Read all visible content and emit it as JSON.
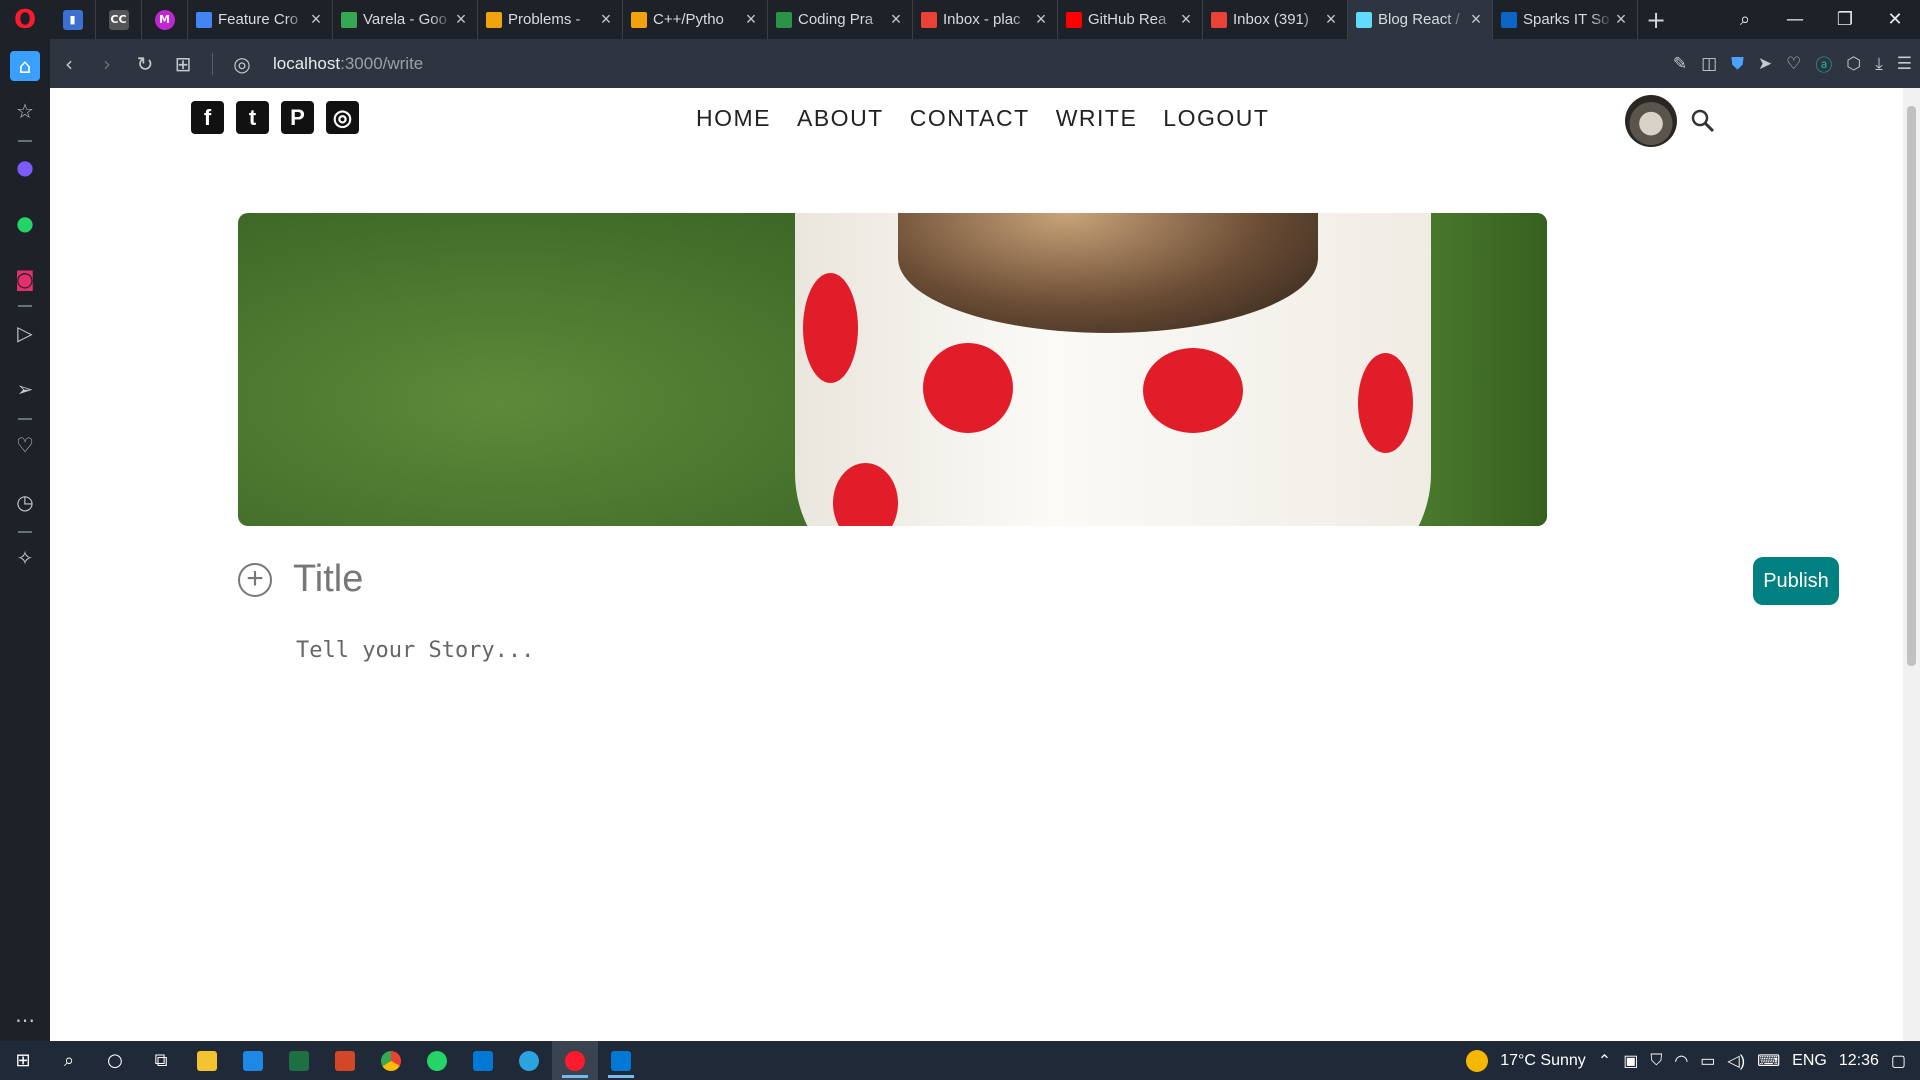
{
  "browser": {
    "pinned": [
      {
        "name": "stats-pin-tab",
        "color": "#4a90e2",
        "glyph": "▮"
      },
      {
        "name": "cc-pin-tab",
        "color": "#555",
        "glyph": "CC"
      },
      {
        "name": "m-pin-tab",
        "color": "#c026d3",
        "glyph": "M"
      }
    ],
    "tabs": [
      {
        "title": "Feature Cro",
        "fav": "#4285f4"
      },
      {
        "title": "Varela - Goo",
        "fav": "#34a853"
      },
      {
        "title": "Problems -",
        "fav": "#f0a30a"
      },
      {
        "title": "C++/Pytho",
        "fav": "#f0a30a"
      },
      {
        "title": "Coding Pra",
        "fav": "#2b9348"
      },
      {
        "title": "Inbox - plac",
        "fav": "#ea4335"
      },
      {
        "title": "GitHub Rea",
        "fav": "#ff0000"
      },
      {
        "title": "Inbox (391)",
        "fav": "#ea4335"
      },
      {
        "title": "Blog React /",
        "fav": "#61dafb",
        "active": true
      },
      {
        "title": "Sparks IT So",
        "fav": "#0a66c2"
      }
    ],
    "url_host": "localhost",
    "url_path": ":3000/write"
  },
  "site": {
    "social": [
      "f",
      "t",
      "P",
      "◎"
    ],
    "menu": [
      "HOME",
      "ABOUT",
      "CONTACT",
      "WRITE",
      "LOGOUT"
    ]
  },
  "write": {
    "add_icon": "+",
    "title_placeholder": "Title",
    "story_placeholder": "Tell your Story...",
    "publish_label": "Publish",
    "accent": "#008080"
  },
  "taskbar": {
    "weather": "17°C  Sunny",
    "lang": "ENG",
    "time": "12:36"
  }
}
